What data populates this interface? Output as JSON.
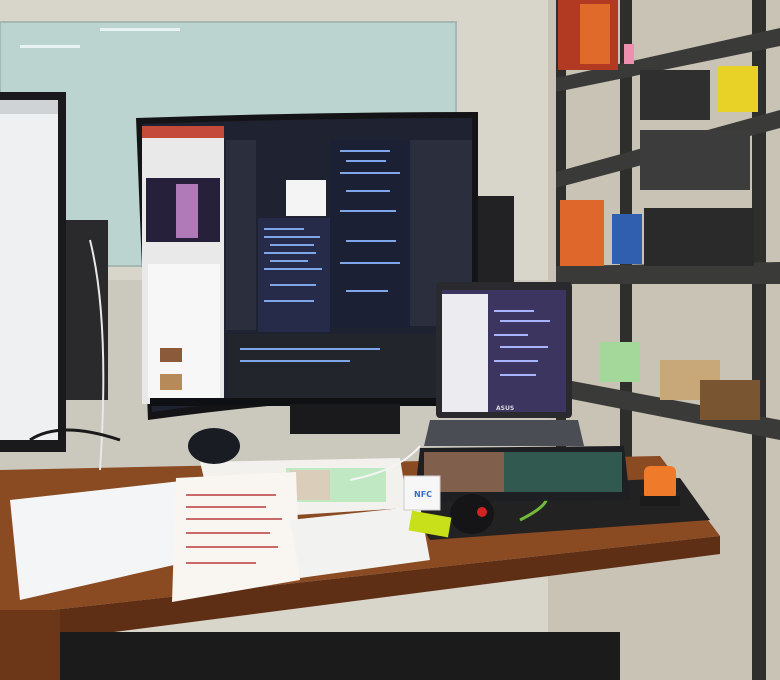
{
  "scene": {
    "description_free": true,
    "laptop_brand": "ASUS",
    "sticker_text": "NFC",
    "colors": {
      "wall": "#d9d6cc",
      "whiteboard": "#b9d3cd",
      "desk": "#8a4a22",
      "shelf": "#3a3a38",
      "monitor_bezel": "#1a1a1c",
      "code_bg": "#1f2230",
      "laptop_screen": "#3b3560",
      "keyboard_glow": "#9fe3a6",
      "orange_device": "#ee7a2a",
      "yellow_box": "#e8d227"
    }
  }
}
